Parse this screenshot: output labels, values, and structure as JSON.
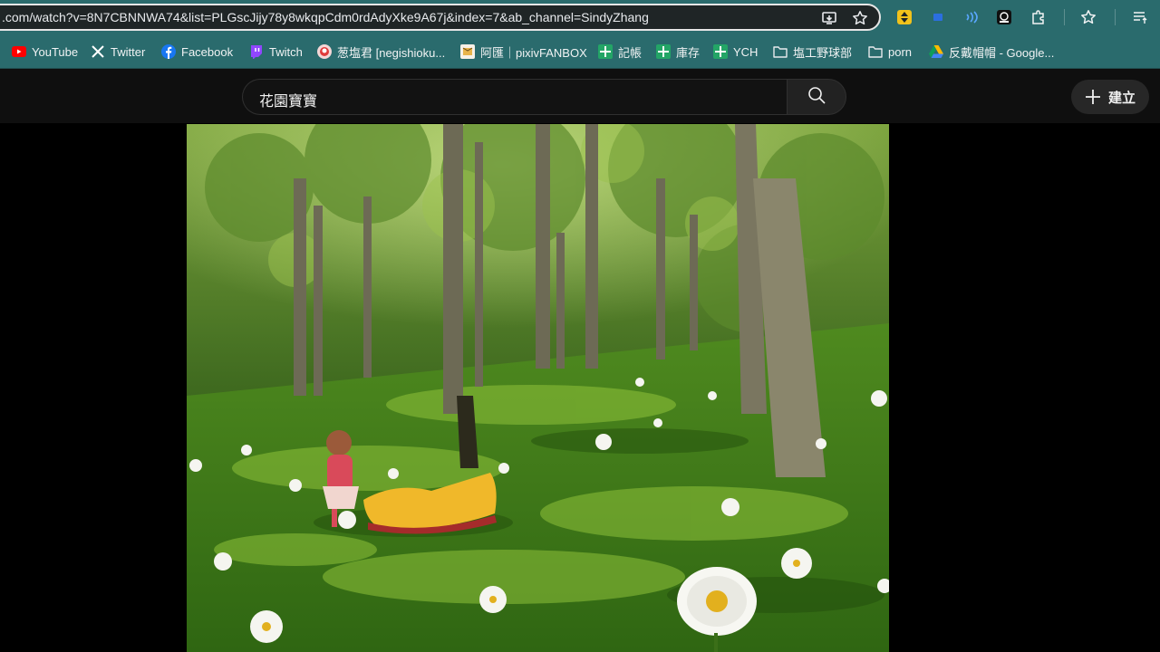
{
  "browser": {
    "url": ".com/watch?v=8N7CBNNWA74&list=PLGscJijy78y8wkqpCdm0rdAdyXke9A67j&index=7&ab_channel=SindyZhang",
    "omnibox_icons": [
      "install-app-icon",
      "bookmark-star-icon"
    ],
    "toolbar_icons": [
      "extension-yellow-icon",
      "extension-blue-icon",
      "extension-wave-icon",
      "extension-screen-icon",
      "extensions-puzzle-icon",
      "bookmarks-star-icon",
      "reading-list-icon"
    ]
  },
  "bookmarks": [
    {
      "label": "YouTube",
      "icon": "youtube-icon"
    },
    {
      "label": "Twitter",
      "icon": "x-icon"
    },
    {
      "label": "Facebook",
      "icon": "facebook-icon"
    },
    {
      "label": "Twitch",
      "icon": "twitch-icon"
    },
    {
      "label": "葱塩君 [negishioku...",
      "icon": "avatar-icon"
    },
    {
      "label": "阿匯｜pixivFANBOX",
      "icon": "fanbox-icon"
    },
    {
      "label": "記帳",
      "icon": "sheets-icon"
    },
    {
      "label": "庫存",
      "icon": "sheets-icon"
    },
    {
      "label": "YCH",
      "icon": "sheets-icon"
    },
    {
      "label": "塩工野球部",
      "icon": "folder-icon"
    },
    {
      "label": "porn",
      "icon": "folder-icon"
    },
    {
      "label": "反戴帽帽 - Google...",
      "icon": "drive-icon"
    }
  ],
  "youtube": {
    "search_query": "花園寶寶",
    "create_label": "建立"
  },
  "colors": {
    "browser_frame": "#2a6b6d",
    "yt_background": "#0f0f0f"
  }
}
